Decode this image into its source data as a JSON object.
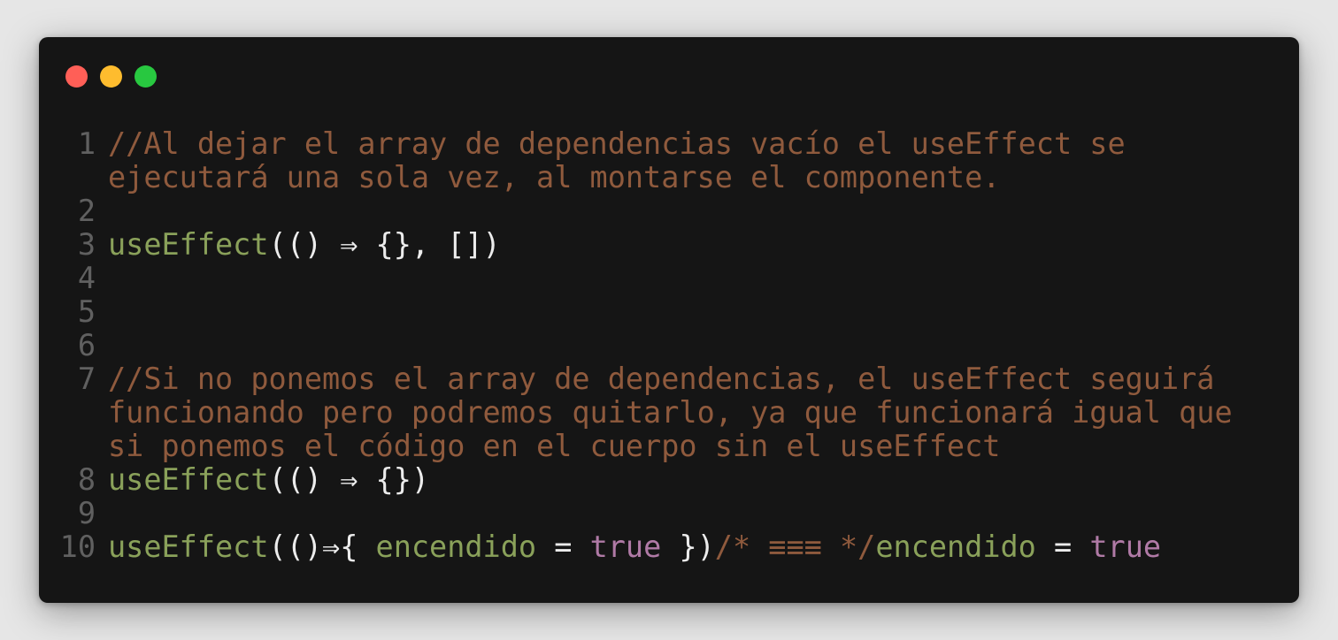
{
  "window": {
    "controls": [
      {
        "name": "close-dot",
        "color": "#ff5f57"
      },
      {
        "name": "minimize-dot",
        "color": "#febc2e"
      },
      {
        "name": "zoom-dot",
        "color": "#28c840"
      }
    ]
  },
  "colors": {
    "background": "#151515",
    "comment": "#8f5a3d",
    "function": "#8aa15a",
    "punctuation": "#ececec",
    "boolean": "#b07aa6",
    "line_number": "#606060"
  },
  "lines": [
    {
      "number": "1",
      "tokens": [
        {
          "type": "comment",
          "text": "//Al dejar el array de dependencias vacío el useEffect se ejecutará una sola vez, al montarse el componente."
        }
      ]
    },
    {
      "number": "2",
      "tokens": []
    },
    {
      "number": "3",
      "tokens": [
        {
          "type": "fn",
          "text": "useEffect"
        },
        {
          "type": "punc",
          "text": "(() ⇒ {}, [])"
        }
      ]
    },
    {
      "number": "4",
      "tokens": []
    },
    {
      "number": "5",
      "tokens": []
    },
    {
      "number": "6",
      "tokens": []
    },
    {
      "number": "7",
      "tokens": [
        {
          "type": "comment",
          "text": "//Si no ponemos el array de dependencias, el useEffect seguirá funcionando pero podremos quitarlo, ya que funcionará igual que si ponemos el código en el cuerpo sin el useEffect"
        }
      ]
    },
    {
      "number": "8",
      "tokens": [
        {
          "type": "fn",
          "text": "useEffect"
        },
        {
          "type": "punc",
          "text": "(() ⇒ {})"
        }
      ]
    },
    {
      "number": "9",
      "tokens": []
    },
    {
      "number": "10",
      "tokens": [
        {
          "type": "fn",
          "text": "useEffect"
        },
        {
          "type": "punc",
          "text": "(()⇒{ "
        },
        {
          "type": "var",
          "text": "encendido"
        },
        {
          "type": "punc",
          "text": " = "
        },
        {
          "type": "bool",
          "text": "true"
        },
        {
          "type": "punc",
          "text": " })"
        },
        {
          "type": "comment",
          "text": "/* ≡≡≡ */"
        },
        {
          "type": "var",
          "text": "encendido"
        },
        {
          "type": "punc",
          "text": " = "
        },
        {
          "type": "bool",
          "text": "true"
        }
      ]
    }
  ]
}
